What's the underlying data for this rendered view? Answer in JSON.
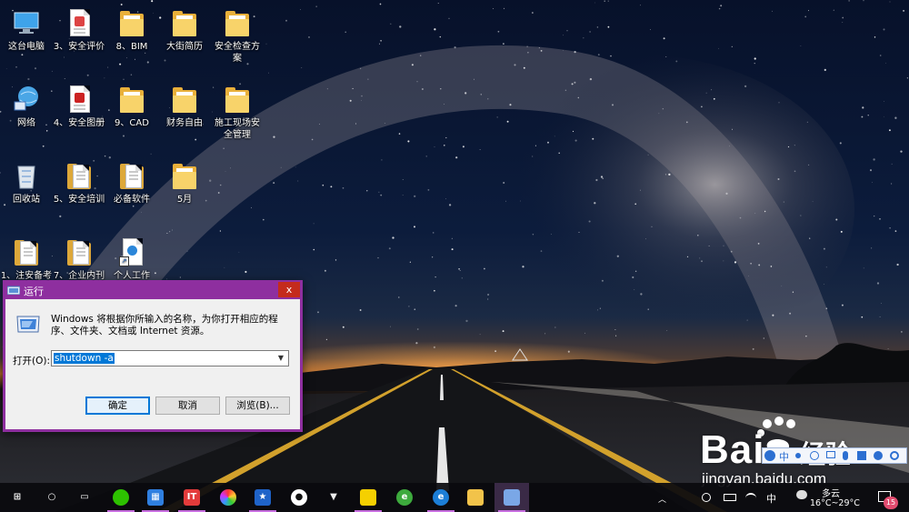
{
  "desktop": {
    "icons": [
      {
        "label": "这台电脑",
        "type": "pc"
      },
      {
        "label": "3、安全评价",
        "type": "doc-red"
      },
      {
        "label": "8、BIM",
        "type": "folder"
      },
      {
        "label": "大街简历",
        "type": "folder"
      },
      {
        "label": "安全检查方案",
        "type": "folder"
      },
      {
        "label": "网络",
        "type": "network"
      },
      {
        "label": "4、安全图册",
        "type": "doc-pdf"
      },
      {
        "label": "9、CAD",
        "type": "folder"
      },
      {
        "label": "财务自由",
        "type": "folder"
      },
      {
        "label": "施工现场安全管理",
        "type": "folder"
      },
      {
        "label": "回收站",
        "type": "recycle"
      },
      {
        "label": "5、安全培训",
        "type": "doc"
      },
      {
        "label": "必备软件",
        "type": "doc"
      },
      {
        "label": "5月",
        "type": "folder"
      },
      {
        "label": "1、注安备考",
        "type": "doc"
      },
      {
        "label": "7、企业内刊",
        "type": "doc"
      },
      {
        "label": "个人工作",
        "type": "ie"
      }
    ]
  },
  "run_dialog": {
    "title": "运行",
    "close_label": "x",
    "description": "Windows 将根据你所输入的名称，为你打开相应的程序、文件夹、文档或 Internet 资源。",
    "open_label": "打开(O):",
    "command_value": "shutdown -a",
    "ok_label": "确定",
    "cancel_label": "取消",
    "browse_label": "浏览(B)..."
  },
  "taskbar": {
    "pinned": [
      "start-icon",
      "cortana-icon",
      "task-view-icon",
      "wechat-icon",
      "calendar-app-icon",
      "app-red-icon",
      "colorful-app-icon",
      "news-app-icon",
      "qq-icon",
      "fox-app-icon",
      "notes-app-icon",
      "ie-green-icon",
      "edge-icon",
      "file-explorer-icon",
      "run-icon"
    ],
    "tray": {
      "ime_label": "中",
      "weather_text": "多云",
      "temperature": "16°C~29°C",
      "notification_count": "15"
    }
  },
  "watermark": {
    "brand": "Bai",
    "brand_cn": "经验",
    "url": "jingyan.baidu.com"
  },
  "colors": {
    "dialog_border": "#8e2f9f",
    "accent": "#0078d7",
    "folder": "#f8d36a"
  }
}
